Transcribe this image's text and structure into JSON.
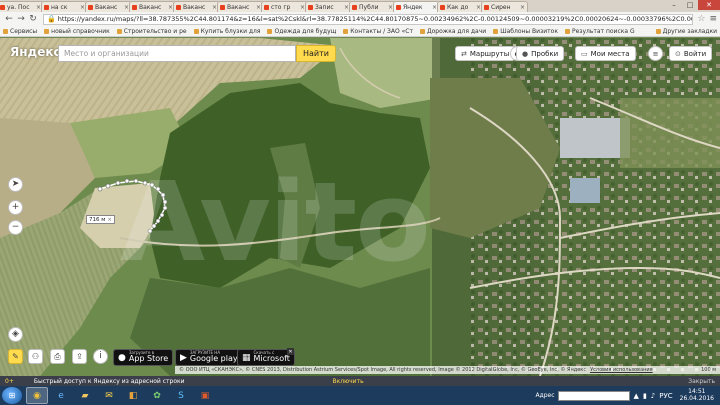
{
  "browser": {
    "tabs": [
      {
        "title": "уа. Пос",
        "active": false
      },
      {
        "title": "на ск",
        "active": false
      },
      {
        "title": "Ваканс",
        "active": false
      },
      {
        "title": "Ваканс",
        "active": false
      },
      {
        "title": "Ваканс",
        "active": false
      },
      {
        "title": "Ваканс",
        "active": false
      },
      {
        "title": "сто гр",
        "active": false
      },
      {
        "title": "Запис",
        "active": false
      },
      {
        "title": "Публи",
        "active": false
      },
      {
        "title": "Яндек",
        "active": true
      },
      {
        "title": "Как до",
        "active": false
      },
      {
        "title": "Сирен",
        "active": false
      }
    ],
    "url": "https://yandex.ru/maps/?ll=38.787355%2C44.801174&z=16&l=sat%2Cskl&rl=38.77825114%2C44.80170875~0.00234962%2C-0.00124509~0.00003219%2C0.00020624~-0.00033796%2C0.00022915",
    "bookmarks": [
      "Сервисы",
      "новый справочник",
      "Строительство и ре",
      "Купить блузки для",
      "Одежда для будущ",
      "Контакты / ЗАО «Ст",
      "Дорожка для дачи",
      "Шаблоны Визиток",
      "Результат поиска G"
    ],
    "bookmarks_other": "Другие закладки"
  },
  "map_header": {
    "logo": "Яндекс",
    "search_placeholder": "Место и организации",
    "find_button": "Найти",
    "routes_button": "Маршруты",
    "traffic_button": "Пробки",
    "my_places_button": "Мои места",
    "login_button": "Войти"
  },
  "map": {
    "distance_label": "716 м",
    "watermark": "Avito",
    "copyright": "© ООО ИТЦ «СКАНЭКС», © CNES 2013, Distribution Astrium Services/Spot Image, All rights reserved, Image © 2012 DigitalGlobe, Inc, © GeoEye, Inc, © Яндекс",
    "terms": "Условия использования",
    "scale": "100 м",
    "store_badges": [
      {
        "small": "Загрузите в",
        "big": "App Store"
      },
      {
        "small": "ЗАГРУЗИТЕ НА",
        "big": "Google play"
      },
      {
        "small": "Скачать с",
        "big": "Microsoft"
      }
    ]
  },
  "yandex_bar": {
    "plus": "0+",
    "message": "Быстрый доступ к Яндексу из адресной строки",
    "enable": "Включить",
    "hide": "Закрыть"
  },
  "taskbar": {
    "address_label": "Адрес",
    "lang": "РУС",
    "time": "14:51",
    "date": "26.04.2016"
  },
  "colors": {
    "yandex_yellow": "#ffdb4d",
    "taskbar": "#1d3b5c"
  }
}
